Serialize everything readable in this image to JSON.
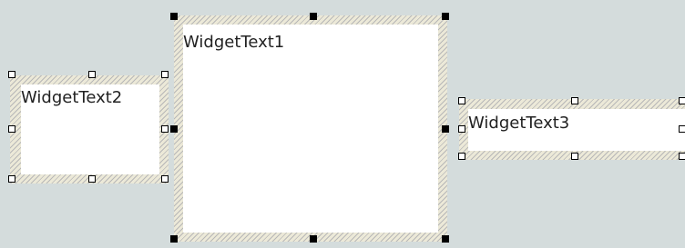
{
  "widgets": [
    {
      "id": "w1",
      "text": "WidgetText1",
      "selected": true
    },
    {
      "id": "w2",
      "text": "WidgetText2",
      "selected": false
    },
    {
      "id": "w3",
      "text": "WidgetText3",
      "selected": false
    }
  ]
}
